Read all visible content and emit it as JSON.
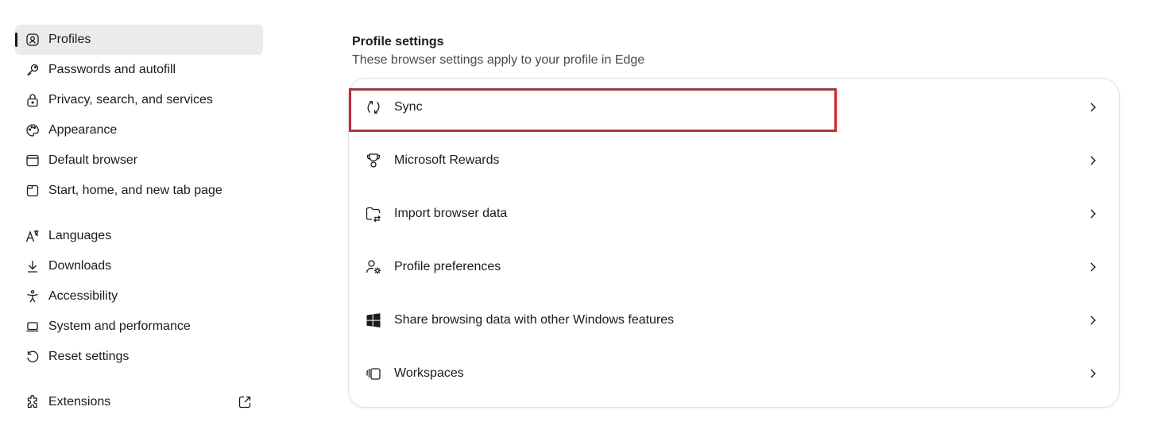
{
  "sidebar": {
    "items": [
      {
        "label": "Profiles",
        "icon": "profile-icon",
        "active": true
      },
      {
        "label": "Passwords and autofill",
        "icon": "key-icon"
      },
      {
        "label": "Privacy, search, and services",
        "icon": "lock-icon"
      },
      {
        "label": "Appearance",
        "icon": "palette-icon"
      },
      {
        "label": "Default browser",
        "icon": "browser-window-icon"
      },
      {
        "label": "Start, home, and new tab page",
        "icon": "tab-page-icon"
      },
      {
        "label": "Languages",
        "icon": "language-icon"
      },
      {
        "label": "Downloads",
        "icon": "download-icon"
      },
      {
        "label": "Accessibility",
        "icon": "accessibility-icon"
      },
      {
        "label": "System and performance",
        "icon": "laptop-icon"
      },
      {
        "label": "Reset settings",
        "icon": "reset-icon"
      },
      {
        "label": "Extensions",
        "icon": "puzzle-icon"
      }
    ]
  },
  "main": {
    "title": "Profile settings",
    "subtitle": "These browser settings apply to your profile in Edge",
    "rows": [
      {
        "label": "Sync",
        "icon": "sync-icon"
      },
      {
        "label": "Microsoft Rewards",
        "icon": "trophy-icon"
      },
      {
        "label": "Import browser data",
        "icon": "import-icon"
      },
      {
        "label": "Profile preferences",
        "icon": "profile-settings-icon"
      },
      {
        "label": "Share browsing data with other Windows features",
        "icon": "windows-icon"
      },
      {
        "label": "Workspaces",
        "icon": "workspaces-icon"
      }
    ]
  },
  "colors": {
    "highlight": "#e0202c",
    "active_bg": "#ebebeb"
  }
}
